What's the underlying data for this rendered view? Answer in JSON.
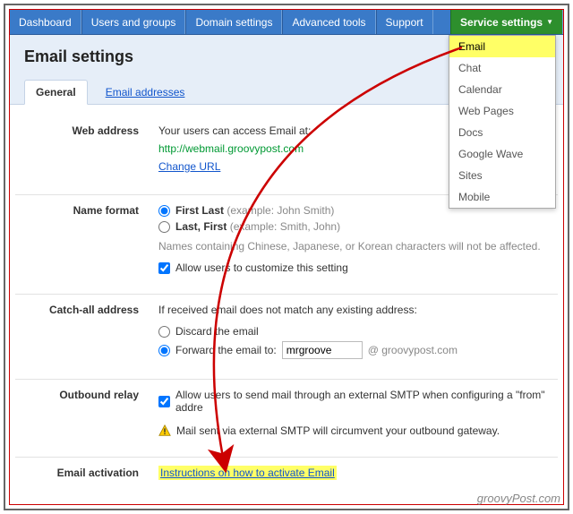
{
  "nav": {
    "dashboard": "Dashboard",
    "users": "Users and groups",
    "domain": "Domain settings",
    "advanced": "Advanced tools",
    "support": "Support",
    "service": "Service settings"
  },
  "dropdown": {
    "email": "Email",
    "chat": "Chat",
    "calendar": "Calendar",
    "webpages": "Web Pages",
    "docs": "Docs",
    "wave": "Google Wave",
    "sites": "Sites",
    "mobile": "Mobile"
  },
  "header": {
    "title": "Email settings"
  },
  "tabs": {
    "general": "General",
    "addresses": "Email addresses"
  },
  "web": {
    "label": "Web address",
    "intro": "Your users can access Email at:",
    "url": "http://webmail.groovypost.com",
    "change": "Change URL"
  },
  "name": {
    "label": "Name format",
    "opt1a": "First Last",
    "opt1b": " (example: John Smith)",
    "opt2a": "Last, First",
    "opt2b": " (example: Smith, John)",
    "note": "Names containing Chinese, Japanese, or Korean characters will not be affected.",
    "customize": "Allow users to customize this setting"
  },
  "catch": {
    "label": "Catch-all address",
    "intro": "If received email does not match any existing address:",
    "discard": "Discard the email",
    "fwd": "Forward the email to:",
    "fwd_value": "mrgroove",
    "suffix": "@ groovypost.com"
  },
  "relay": {
    "label": "Outbound relay",
    "allow": "Allow users to send mail through an external SMTP when configuring a \"from\" addre",
    "warn": "Mail sent via external SMTP will circumvent your outbound gateway."
  },
  "activation": {
    "label": "Email activation",
    "link": "Instructions on how to activate Email"
  },
  "watermark": "groovyPost.com"
}
